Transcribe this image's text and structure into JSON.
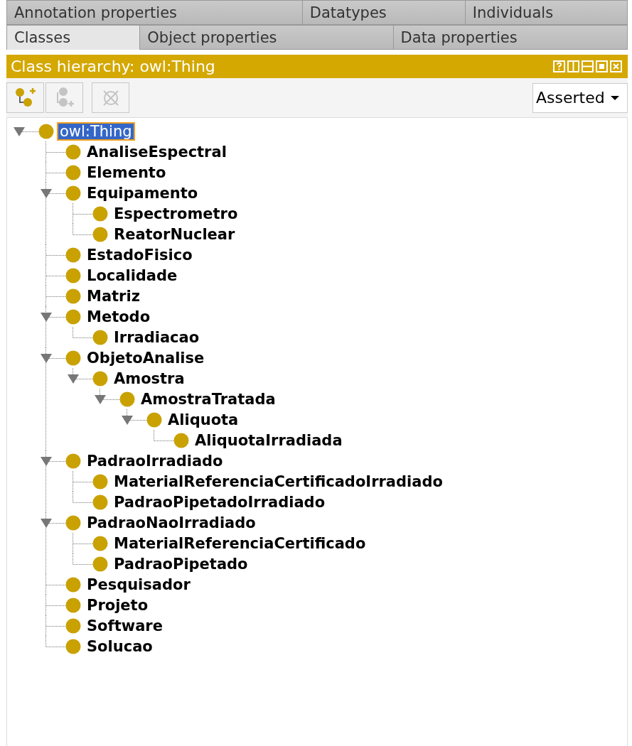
{
  "tab_rows": [
    [
      {
        "label": "Annotation properties",
        "selected": false
      },
      {
        "label": "Datatypes",
        "selected": false
      },
      {
        "label": "Individuals",
        "selected": false
      }
    ],
    [
      {
        "label": "Classes",
        "selected": true
      },
      {
        "label": "Object properties",
        "selected": false
      },
      {
        "label": "Data properties",
        "selected": false
      }
    ]
  ],
  "view": {
    "title": "Class hierarchy: owl:Thing"
  },
  "toolbar": {
    "buttons": [
      {
        "kind": "add-subclass",
        "disabled": false
      },
      {
        "kind": "add-sibling",
        "disabled": true
      },
      {
        "kind": "delete",
        "disabled": true
      }
    ],
    "mode": "Asserted"
  },
  "tree": [
    {
      "label": "owl:Thing",
      "selected": true,
      "expanded": true,
      "children": [
        {
          "label": "AnaliseEspectral",
          "selected": false
        },
        {
          "label": "Elemento",
          "selected": false
        },
        {
          "label": "Equipamento",
          "selected": false,
          "expanded": true,
          "children": [
            {
              "label": "Espectrometro",
              "selected": false
            },
            {
              "label": "ReatorNuclear",
              "selected": false
            }
          ]
        },
        {
          "label": "EstadoFisico",
          "selected": false
        },
        {
          "label": "Localidade",
          "selected": false
        },
        {
          "label": "Matriz",
          "selected": false
        },
        {
          "label": "Metodo",
          "selected": false,
          "expanded": true,
          "children": [
            {
              "label": "Irradiacao",
              "selected": false
            }
          ]
        },
        {
          "label": "ObjetoAnalise",
          "selected": false,
          "expanded": true,
          "children": [
            {
              "label": "Amostra",
              "selected": false,
              "expanded": true,
              "children": [
                {
                  "label": "AmostraTratada",
                  "selected": false,
                  "expanded": true,
                  "children": [
                    {
                      "label": "Aliquota",
                      "selected": false,
                      "expanded": true,
                      "children": [
                        {
                          "label": "AliquotaIrradiada",
                          "selected": false
                        }
                      ]
                    }
                  ]
                }
              ]
            }
          ]
        },
        {
          "label": "PadraoIrradiado",
          "selected": false,
          "expanded": true,
          "children": [
            {
              "label": "MaterialReferenciaCertificadoIrradiado",
              "selected": false
            },
            {
              "label": "PadraoPipetadoIrradiado",
              "selected": false
            }
          ]
        },
        {
          "label": "PadraoNaoIrradiado",
          "selected": false,
          "expanded": true,
          "children": [
            {
              "label": "MaterialReferenciaCertificado",
              "selected": false
            },
            {
              "label": "PadraoPipetado",
              "selected": false
            }
          ]
        },
        {
          "label": "Pesquisador",
          "selected": false
        },
        {
          "label": "Projeto",
          "selected": false
        },
        {
          "label": "Software",
          "selected": false
        },
        {
          "label": "Solucao",
          "selected": false
        }
      ]
    }
  ]
}
